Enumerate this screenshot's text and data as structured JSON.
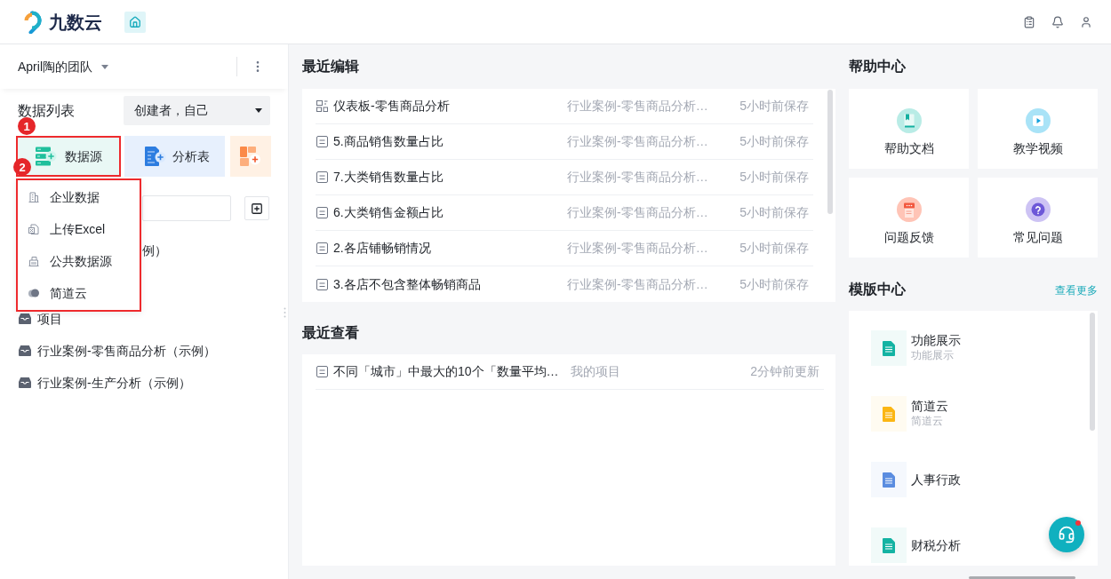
{
  "header": {
    "logo": "九数云",
    "home_button": {
      "selected": true
    }
  },
  "sidebar": {
    "team": "April陶的团队",
    "section_title": "数据列表",
    "creator_filter": "创建者，自己",
    "create_tiles": [
      {
        "kind": "data",
        "label": "数据源",
        "annotation": "1"
      },
      {
        "kind": "table",
        "label": "分析表"
      },
      {
        "kind": "grid"
      }
    ],
    "tree": [
      {
        "kind": "fragment",
        "label": "例）"
      },
      {
        "kind": "folder",
        "label": "项目"
      },
      {
        "kind": "folder",
        "label": "行业案例-零售商品分析（示例）"
      },
      {
        "kind": "folder",
        "label": "行业案例-生产分析（示例）"
      }
    ]
  },
  "create_menu": {
    "annotation": "2",
    "items": [
      {
        "kind": "building",
        "label": "企业数据"
      },
      {
        "kind": "excel",
        "label": "上传Excel"
      },
      {
        "kind": "public",
        "label": "公共数据源"
      },
      {
        "kind": "cloud",
        "label": "简道云"
      }
    ]
  },
  "recent_edits": {
    "title": "最近编辑",
    "rows": [
      {
        "kind": "dashboard",
        "name": "仪表板-零售商品分析",
        "location": "行业案例-零售商品分析…",
        "time": "5小时前保存"
      },
      {
        "kind": "table",
        "name": "5.商品销售数量占比",
        "location": "行业案例-零售商品分析…",
        "time": "5小时前保存"
      },
      {
        "kind": "table",
        "name": "7.大类销售数量占比",
        "location": "行业案例-零售商品分析…",
        "time": "5小时前保存"
      },
      {
        "kind": "table",
        "name": "6.大类销售金额占比",
        "location": "行业案例-零售商品分析…",
        "time": "5小时前保存"
      },
      {
        "kind": "table",
        "name": "2.各店铺畅销情况",
        "location": "行业案例-零售商品分析…",
        "time": "5小时前保存"
      },
      {
        "kind": "table",
        "name": "3.各店不包含整体畅销商品",
        "location": "行业案例-零售商品分析…",
        "time": "5小时前保存"
      }
    ]
  },
  "recent_views": {
    "title": "最近查看",
    "rows": [
      {
        "kind": "table",
        "name": "不同「城市」中最大的10个「数量平均…",
        "location": "我的项目",
        "time": "2分钟前更新"
      }
    ]
  },
  "help_center": {
    "title": "帮助中心",
    "tiles": [
      {
        "kind": "docs",
        "label": "帮助文档"
      },
      {
        "kind": "video",
        "label": "教学视频"
      },
      {
        "kind": "feedback",
        "label": "问题反馈"
      },
      {
        "kind": "faq",
        "label": "常见问题"
      }
    ]
  },
  "template_center": {
    "title": "模版中心",
    "more_link": "查看更多",
    "items": [
      {
        "title": "功能展示",
        "subtitle": "功能展示",
        "color": "#14b3a3"
      },
      {
        "title": "简道云",
        "subtitle": "简道云",
        "color": "#fbb614"
      },
      {
        "title": "人事行政",
        "color": "#5b8de0"
      },
      {
        "title": "财税分析",
        "color": "#14b3a3"
      }
    ]
  },
  "chat_button": {
    "notification": true
  }
}
